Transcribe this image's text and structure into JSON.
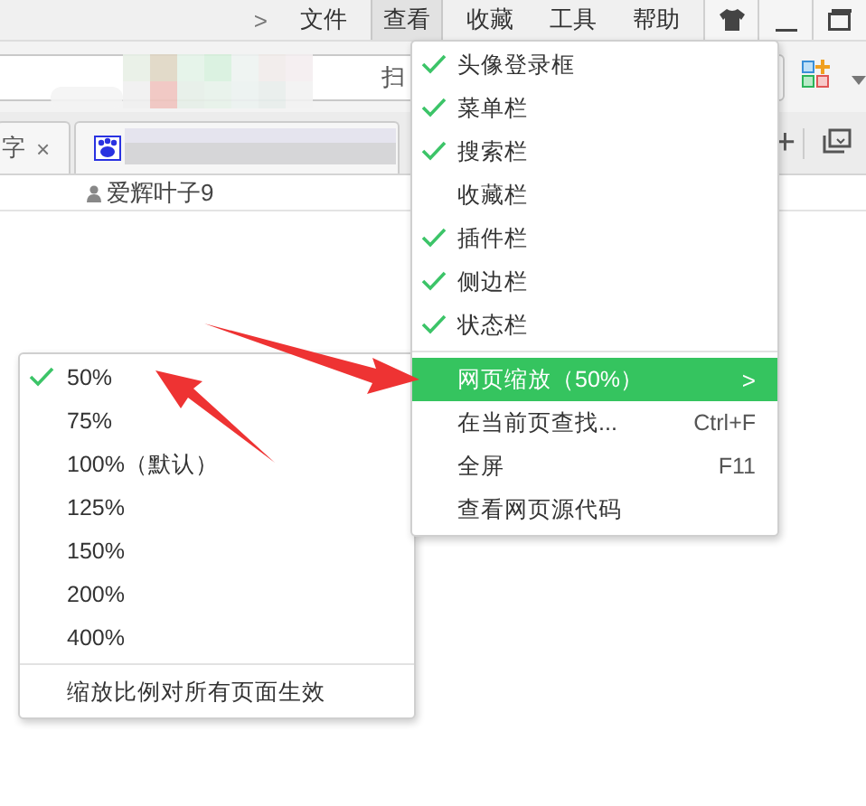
{
  "menu_bar": {
    "more": ">",
    "items": [
      {
        "label": "文件",
        "selected": false
      },
      {
        "label": "查看",
        "selected": true
      },
      {
        "label": "收藏",
        "selected": false
      },
      {
        "label": "工具",
        "selected": false
      },
      {
        "label": "帮助",
        "selected": false
      }
    ]
  },
  "address_bar": {
    "value": "扫"
  },
  "tabs": [
    {
      "label": "字",
      "close": "×"
    },
    {
      "kind": "favicon"
    }
  ],
  "new_tab": "+",
  "bookmarks": [
    {
      "label": "爱辉叶子9"
    }
  ],
  "view_menu": {
    "items": [
      {
        "kind": "check",
        "label": "头像登录框",
        "checked": true
      },
      {
        "kind": "check",
        "label": "菜单栏",
        "checked": true
      },
      {
        "kind": "check",
        "label": "搜索栏",
        "checked": true
      },
      {
        "kind": "check",
        "label": "收藏栏",
        "checked": false
      },
      {
        "kind": "check",
        "label": "插件栏",
        "checked": true
      },
      {
        "kind": "check",
        "label": "侧边栏",
        "checked": true
      },
      {
        "kind": "check",
        "label": "状态栏",
        "checked": true
      },
      {
        "kind": "separator"
      },
      {
        "kind": "submenu",
        "label": "网页缩放（50%）",
        "highlighted": true,
        "arrow": ">"
      },
      {
        "kind": "action",
        "label": "在当前页查找...",
        "highlighted": false,
        "shortcut": "Ctrl+F"
      },
      {
        "kind": "action",
        "label": "全屏",
        "highlighted": false,
        "shortcut": "F11"
      },
      {
        "kind": "action",
        "label": "查看网页源代码",
        "highlighted": false
      }
    ]
  },
  "zoom_submenu": {
    "items": [
      {
        "kind": "check",
        "label": "50%",
        "checked": true
      },
      {
        "kind": "check",
        "label": "75%",
        "checked": false
      },
      {
        "kind": "check",
        "label": "100%（默认）",
        "checked": false
      },
      {
        "kind": "check",
        "label": "125%",
        "checked": false
      },
      {
        "kind": "check",
        "label": "150%",
        "checked": false
      },
      {
        "kind": "check",
        "label": "200%",
        "checked": false
      },
      {
        "kind": "check",
        "label": "400%",
        "checked": false
      },
      {
        "kind": "separator"
      },
      {
        "kind": "action",
        "label": "缩放比例对所有页面生效",
        "highlighted": false
      }
    ]
  }
}
